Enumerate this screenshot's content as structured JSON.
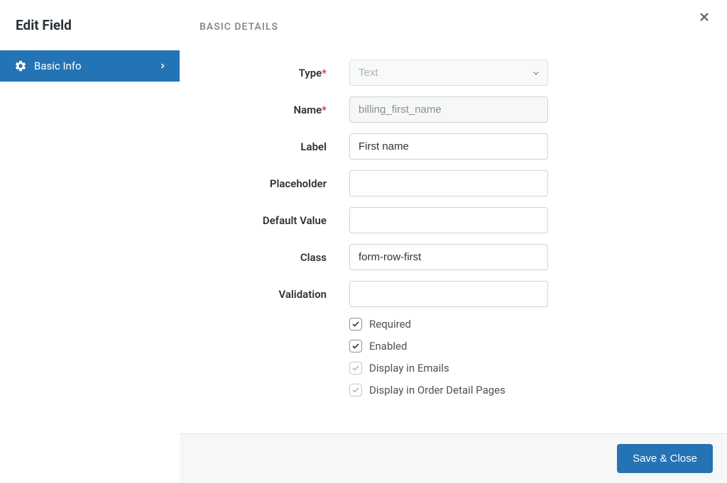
{
  "header": {
    "title": "Edit Field"
  },
  "sidebar": {
    "items": [
      {
        "label": "Basic Info"
      }
    ]
  },
  "section": {
    "title": "BASIC DETAILS"
  },
  "form": {
    "type": {
      "label": "Type",
      "value": "Text",
      "required": true
    },
    "name": {
      "label": "Name",
      "value": "billing_first_name",
      "required": true
    },
    "labelField": {
      "label": "Label",
      "value": "First name"
    },
    "placeholder": {
      "label": "Placeholder",
      "value": ""
    },
    "defaultValue": {
      "label": "Default Value",
      "value": ""
    },
    "class": {
      "label": "Class",
      "value": "form-row-first"
    },
    "validation": {
      "label": "Validation",
      "value": ""
    },
    "checkboxes": {
      "required": {
        "label": "Required",
        "checked": true,
        "disabled": false
      },
      "enabled": {
        "label": "Enabled",
        "checked": true,
        "disabled": false
      },
      "displayEmails": {
        "label": "Display in Emails",
        "checked": true,
        "disabled": true
      },
      "displayOrderPages": {
        "label": "Display in Order Detail Pages",
        "checked": true,
        "disabled": true
      }
    }
  },
  "footer": {
    "saveLabel": "Save & Close"
  }
}
